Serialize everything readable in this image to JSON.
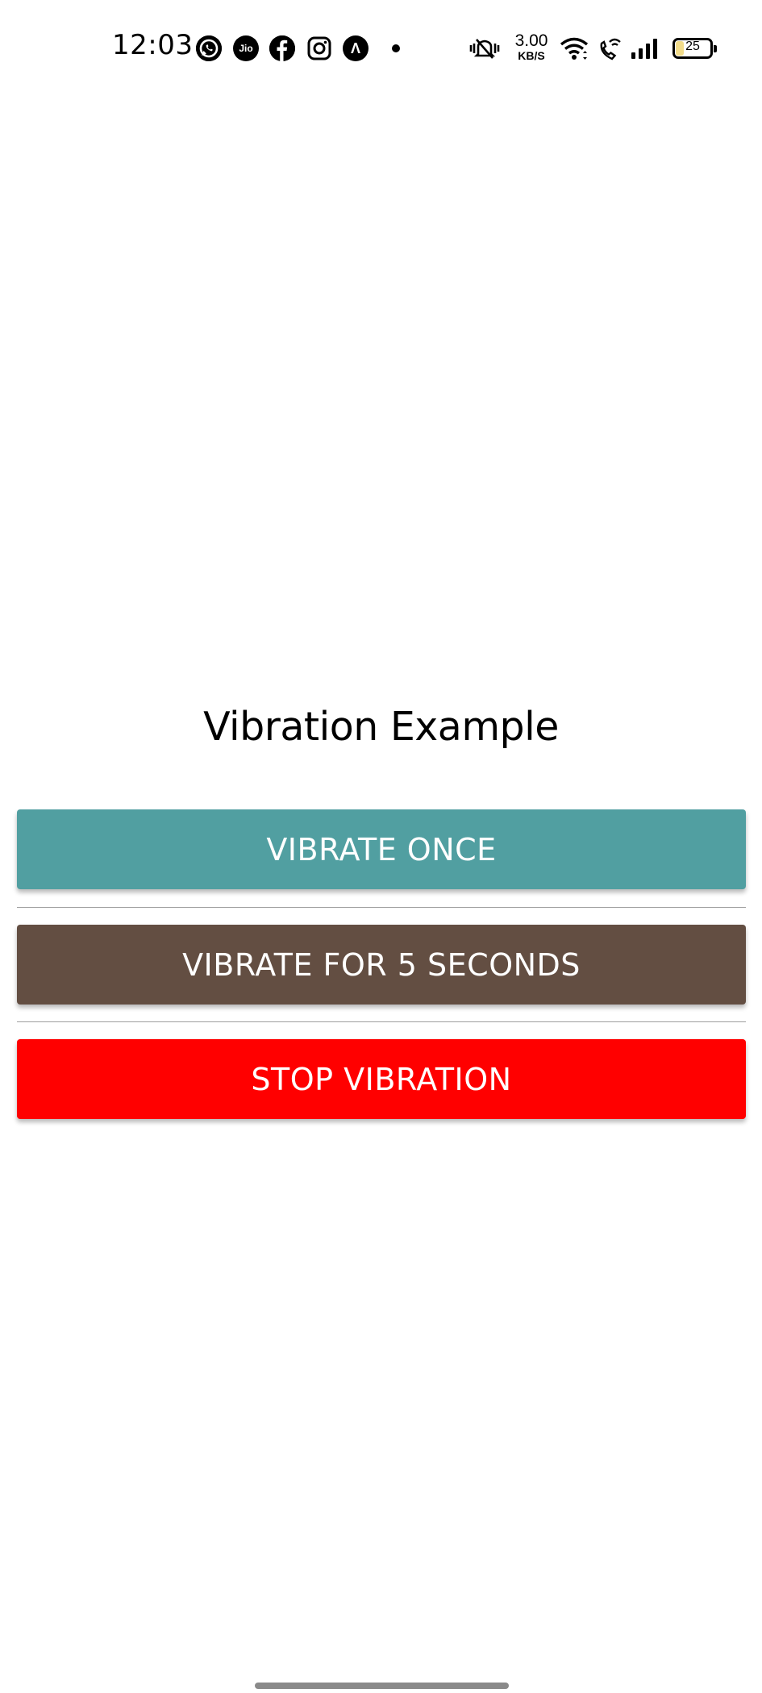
{
  "status_bar": {
    "time": "12:03",
    "notification_icons": [
      "whatsapp-icon",
      "jio-icon",
      "facebook-icon",
      "instagram-icon",
      "app-a-icon"
    ],
    "jio_label": "Jio",
    "app_a_label": "Λ",
    "network_speed_value": "3.00",
    "network_speed_unit": "KB/S",
    "system_icons": [
      "silent-mode-icon",
      "wifi-icon",
      "wifi-calling-icon",
      "signal-icon",
      "battery-icon"
    ],
    "battery_level": "25"
  },
  "main": {
    "title": "Vibration Example",
    "buttons": [
      {
        "label": "VIBRATE ONCE",
        "color": "#519fa1"
      },
      {
        "label": "VIBRATE FOR 5 SECONDS",
        "color": "#634e42"
      },
      {
        "label": "STOP VIBRATION",
        "color": "#ff0000"
      }
    ]
  }
}
